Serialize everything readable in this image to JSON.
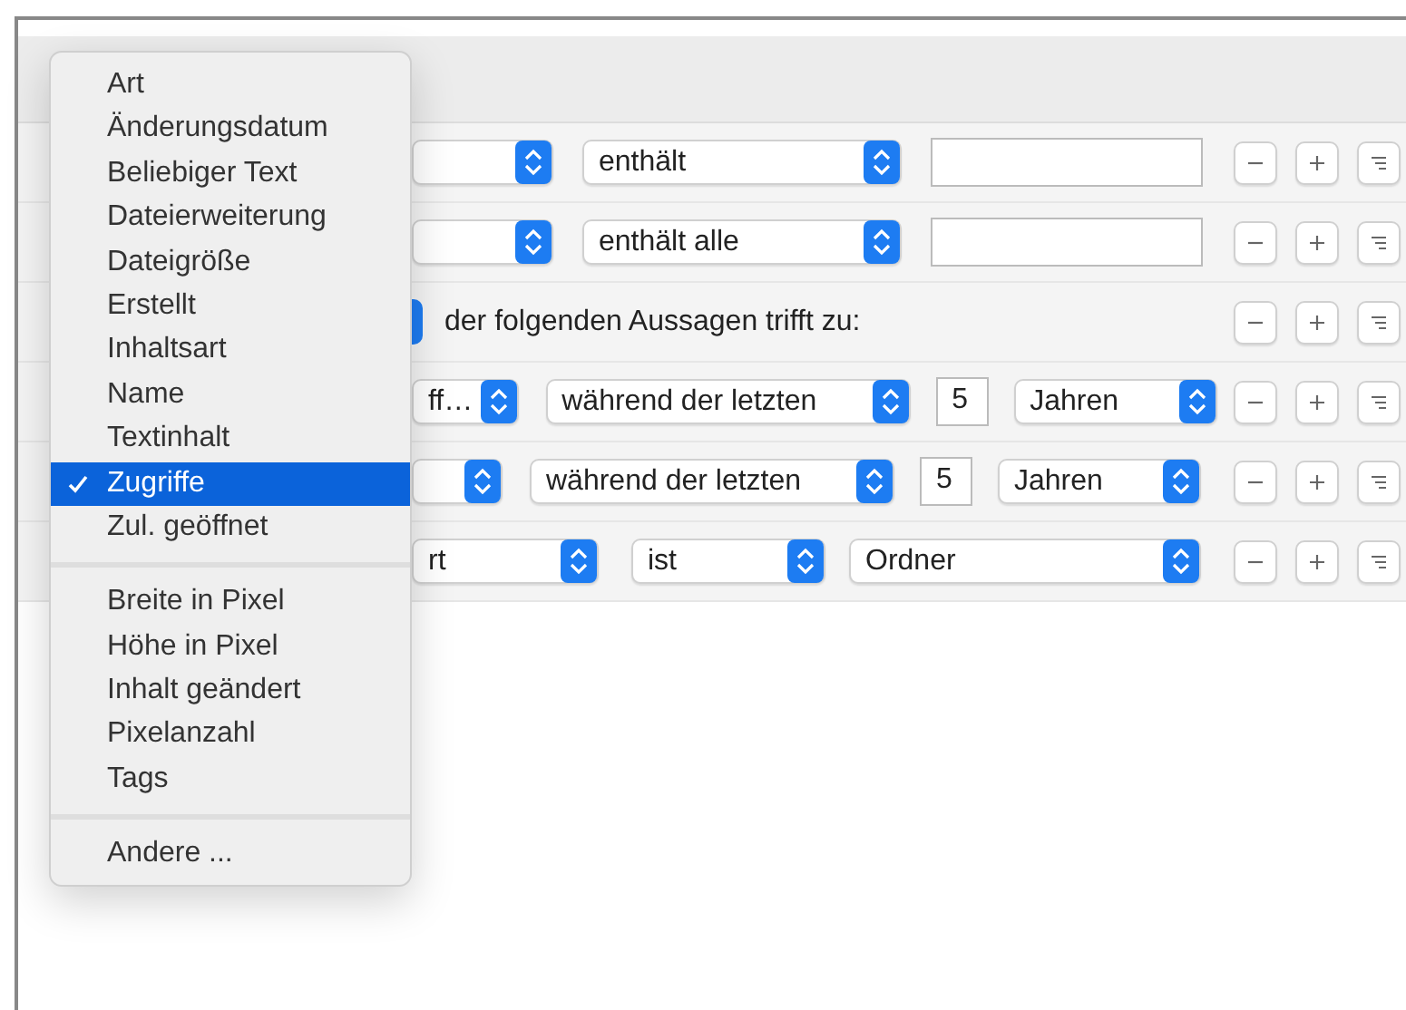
{
  "rows": [
    {
      "controls": [
        {
          "kind": "popup"
        },
        {
          "kind": "popup",
          "text": "enthält"
        },
        {
          "kind": "field"
        }
      ]
    },
    {
      "controls": [
        {
          "kind": "popup"
        },
        {
          "kind": "popup",
          "text": "enthält alle"
        },
        {
          "kind": "field"
        }
      ]
    },
    {
      "controls": [
        {
          "kind": "stub"
        },
        {
          "kind": "label",
          "text": "der folgenden Aussagen trifft zu:"
        }
      ]
    },
    {
      "controls": [
        {
          "kind": "popup",
          "text": "ff…"
        },
        {
          "kind": "popup",
          "text": "während der letzten"
        },
        {
          "kind": "field",
          "text": "5"
        },
        {
          "kind": "popup",
          "text": "Jahren"
        }
      ]
    },
    {
      "controls": [
        {
          "kind": "popup"
        },
        {
          "kind": "popup",
          "text": "während der letzten"
        },
        {
          "kind": "field",
          "text": "5"
        },
        {
          "kind": "popup",
          "text": "Jahren"
        }
      ]
    },
    {
      "controls": [
        {
          "kind": "popup",
          "text": "rt"
        },
        {
          "kind": "popup",
          "text": "ist"
        },
        {
          "kind": "popup",
          "text": "Ordner"
        }
      ]
    }
  ],
  "menu": {
    "groups": [
      [
        {
          "label": "Art",
          "selected": false
        },
        {
          "label": "Änderungsdatum",
          "selected": false
        },
        {
          "label": "Beliebiger Text",
          "selected": false
        },
        {
          "label": "Dateierweiterung",
          "selected": false
        },
        {
          "label": "Dateigröße",
          "selected": false
        },
        {
          "label": "Erstellt",
          "selected": false
        },
        {
          "label": "Inhaltsart",
          "selected": false
        },
        {
          "label": "Name",
          "selected": false
        },
        {
          "label": "Textinhalt",
          "selected": false
        },
        {
          "label": "Zugriffe",
          "selected": true
        },
        {
          "label": "Zul. geöffnet",
          "selected": false
        }
      ],
      [
        {
          "label": "Breite in Pixel",
          "selected": false
        },
        {
          "label": "Höhe in Pixel",
          "selected": false
        },
        {
          "label": "Inhalt geändert",
          "selected": false
        },
        {
          "label": "Pixelanzahl",
          "selected": false
        },
        {
          "label": "Tags",
          "selected": false
        }
      ],
      [
        {
          "label": "Andere ...",
          "selected": false
        }
      ]
    ]
  }
}
